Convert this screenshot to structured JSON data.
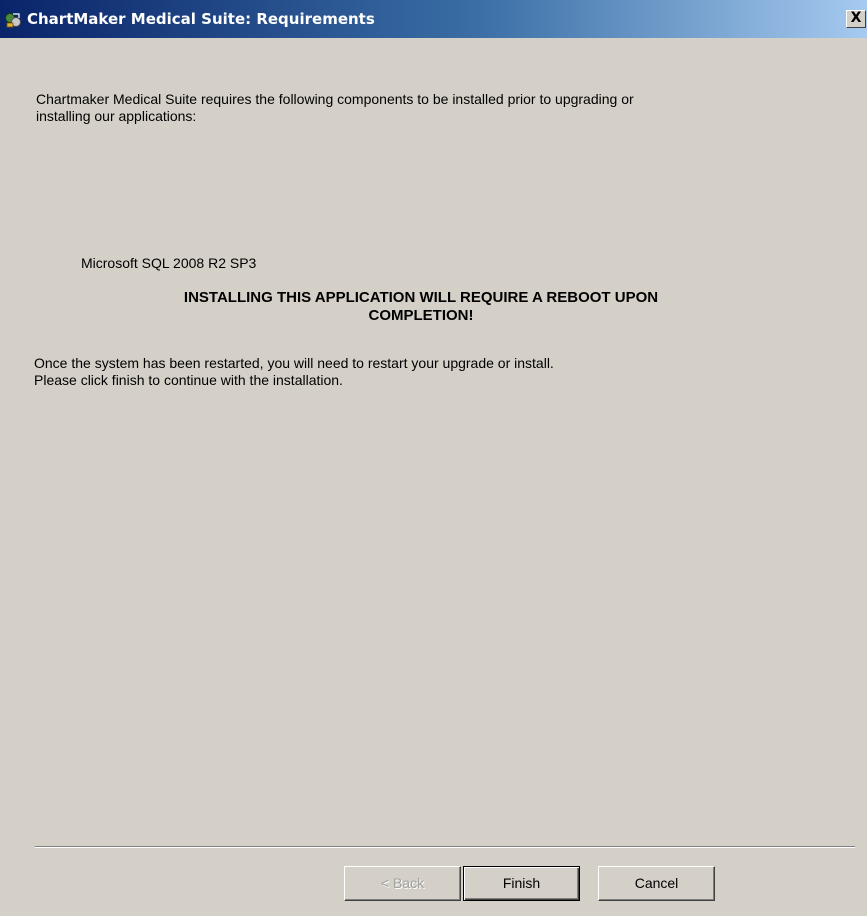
{
  "window": {
    "title": "ChartMaker Medical Suite: Requirements",
    "close_label": "X",
    "title_icon": "installer-icon"
  },
  "main": {
    "intro_line1": "Chartmaker Medical Suite requires the following components to be installed prior to upgrading or",
    "intro_line2": "installing our applications:",
    "component": "Microsoft SQL 2008 R2 SP3",
    "warning_line1": "INSTALLING THIS APPLICATION WILL REQUIRE A REBOOT UPON",
    "warning_line2": "COMPLETION!",
    "note_line1": "Once the system has been restarted, you will need to restart your upgrade or install.",
    "note_line2": "Please click finish to continue with the installation."
  },
  "buttons": {
    "back_label": "< Back",
    "finish_label": "Finish",
    "cancel_label": "Cancel"
  },
  "colors": {
    "dialog_background": "#d4d0c8",
    "titlebar_start": "#0a246a",
    "titlebar_end": "#a6caf0"
  }
}
